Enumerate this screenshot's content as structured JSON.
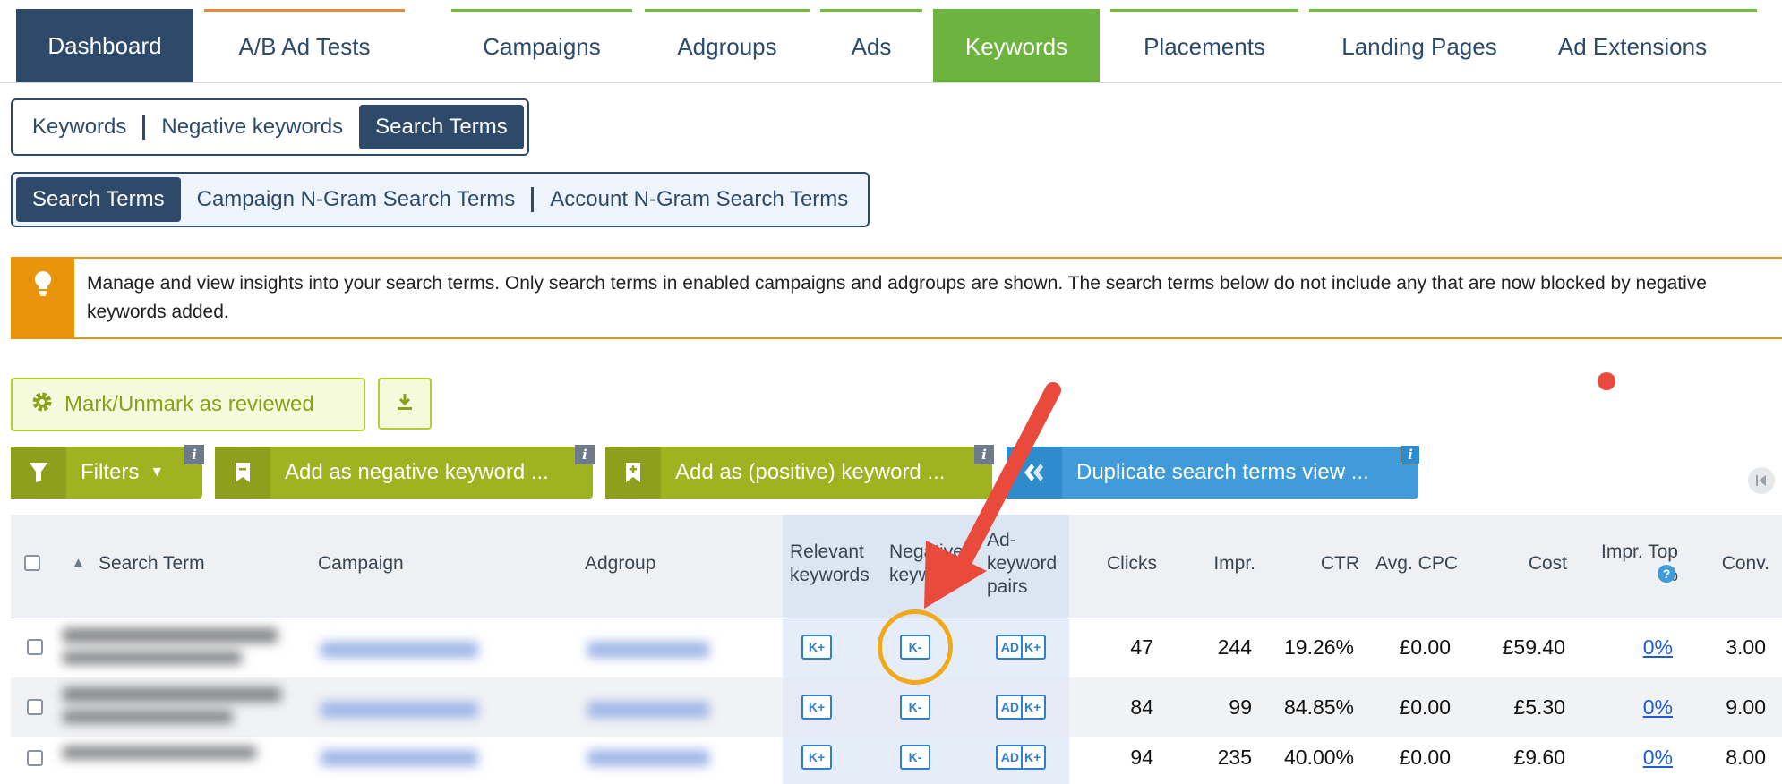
{
  "topnav": {
    "tabs": [
      {
        "label": "Dashboard"
      },
      {
        "label": "A/B Ad Tests"
      },
      {
        "label": "Campaigns"
      },
      {
        "label": "Adgroups"
      },
      {
        "label": "Ads"
      },
      {
        "label": "Keywords"
      },
      {
        "label": "Placements"
      },
      {
        "label": "Landing Pages"
      },
      {
        "label": "Ad Extensions"
      }
    ],
    "active": "Keywords"
  },
  "subnav1": {
    "items": [
      "Keywords",
      "Negative keywords",
      "Search Terms"
    ],
    "selected": "Search Terms"
  },
  "subnav2": {
    "items": [
      "Search Terms",
      "Campaign N-Gram Search Terms",
      "Account N-Gram Search Terms"
    ],
    "selected": "Search Terms"
  },
  "banner": {
    "icon": "lightbulb-icon",
    "text": "Manage and view insights into your search terms. Only search terms in enabled campaigns and adgroups are shown. The search terms below do not include any that are now blocked by negative keywords added."
  },
  "actions": {
    "mark_reviewed": "Mark/Unmark as reviewed",
    "filters": "Filters",
    "add_negative": "Add as negative keyword ...",
    "add_positive": "Add as (positive) keyword ...",
    "duplicate_view": "Duplicate search terms view ...",
    "info": "i"
  },
  "table": {
    "headers": {
      "search_term": "Search Term",
      "campaign": "Campaign",
      "adgroup": "Adgroup",
      "relevant": "Relevant keywords",
      "negative": "Negative keywords",
      "adkw": "Ad-keyword pairs",
      "clicks": "Clicks",
      "impr": "Impr.",
      "ctr": "CTR",
      "avg_cpc": "Avg. CPC",
      "cost": "Cost",
      "impr_top": "Impr. Top %",
      "conv": "Conv."
    },
    "buttons": {
      "kplus": "K+",
      "kminus": "K-",
      "ad": "AD",
      "adk": "K+"
    },
    "rows": [
      {
        "clicks": "47",
        "impr": "244",
        "ctr": "19.26%",
        "avg_cpc": "£0.00",
        "cost": "£59.40",
        "impr_top": "0%",
        "conv": "3.00"
      },
      {
        "clicks": "84",
        "impr": "99",
        "ctr": "84.85%",
        "avg_cpc": "£0.00",
        "cost": "£5.30",
        "impr_top": "0%",
        "conv": "9.00"
      },
      {
        "clicks": "94",
        "impr": "235",
        "ctr": "40.00%",
        "avg_cpc": "£0.00",
        "cost": "£9.60",
        "impr_top": "0%",
        "conv": "8.00"
      }
    ]
  },
  "colors": {
    "navy": "#2e4a6b",
    "green": "#6db33f",
    "olive": "#9fb320",
    "blue": "#3f9bd9",
    "orange": "#e8950b",
    "annotation_red": "#ea4a3c",
    "annotation_circle": "#f2a81b"
  }
}
